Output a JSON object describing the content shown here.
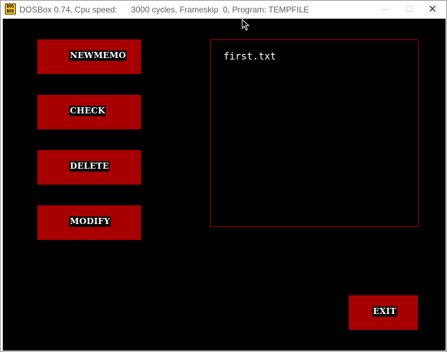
{
  "window": {
    "title": "DOSBox 0.74, Cpu speed:      3000 cycles, Frameskip  0, Program: TEMPFILE",
    "icon": "dosbox-icon",
    "icon_text": "DOS BOX",
    "minimize_symbol": "—",
    "maximize_symbol": "☐",
    "close_symbol": "✕"
  },
  "menu": {
    "buttons": [
      {
        "label": "NEWMEMO"
      },
      {
        "label": "CHECK"
      },
      {
        "label": "DELETE"
      },
      {
        "label": "MODIFY"
      }
    ]
  },
  "file_list": {
    "items": [
      "first.txt"
    ]
  },
  "exit": {
    "label": "EXIT"
  },
  "colors": {
    "background": "#000000",
    "button": "#a80000",
    "text": "#ffffff",
    "list_border": "#a80000"
  }
}
